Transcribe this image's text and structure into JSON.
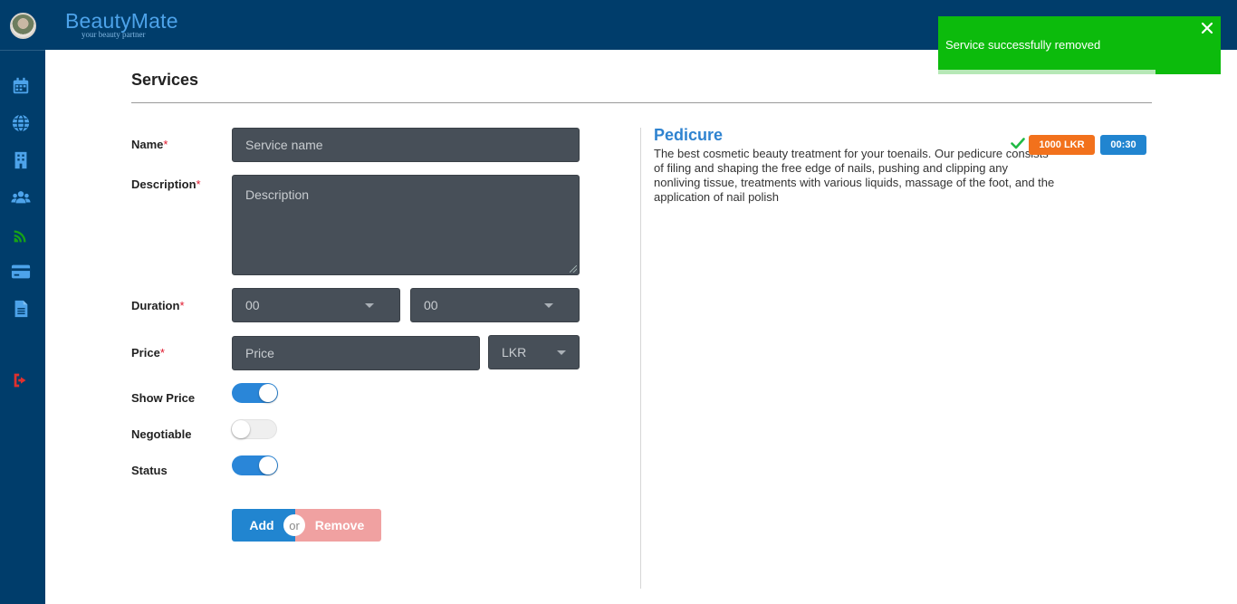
{
  "app": {
    "brand_name": "BeautyMate",
    "brand_tagline": "your beauty partner"
  },
  "sidebar": {
    "items": [
      {
        "icon": "calendar-icon",
        "color": "#4da3ea"
      },
      {
        "icon": "globe-icon",
        "color": "#4da3ea"
      },
      {
        "icon": "building-icon",
        "color": "#4da3ea"
      },
      {
        "icon": "users-icon",
        "color": "#4da3ea"
      },
      {
        "icon": "wifi-signal-icon",
        "color": "#17a317"
      },
      {
        "icon": "credit-card-icon",
        "color": "#4da3ea"
      },
      {
        "icon": "document-icon",
        "color": "#4da3ea"
      },
      {
        "icon": "sign-out-icon",
        "color": "#e0302e"
      }
    ]
  },
  "page": {
    "title": "Services"
  },
  "form": {
    "name": {
      "label": "Name",
      "required": "*",
      "placeholder": "Service name",
      "value": ""
    },
    "description": {
      "label": "Description",
      "required": "*",
      "placeholder": "Description",
      "value": ""
    },
    "duration": {
      "label": "Duration",
      "required": "*",
      "hours": "00",
      "minutes": "00"
    },
    "price": {
      "label": "Price",
      "required": "*",
      "placeholder": "Price",
      "value": "",
      "currency": "LKR"
    },
    "show_price": {
      "label": "Show Price",
      "checked": true
    },
    "negotiable": {
      "label": "Negotiable",
      "checked": false
    },
    "status": {
      "label": "Status",
      "checked": true
    },
    "add_label": "Add",
    "or_label": "or",
    "remove_label": "Remove"
  },
  "service_card": {
    "name": "Pedicure",
    "description": "The best cosmetic beauty treatment for your toenails. Our pedicure consists of filing and shaping the free edge of nails, pushing and clipping any nonliving tissue, treatments with various liquids, massage of the foot, and the application of nail polish",
    "status_icon": "check-icon",
    "price_badge": "1000 LKR",
    "duration_badge": "00:30"
  },
  "toast": {
    "message": "Service successfully removed",
    "progress": 0.77,
    "color": "#0cbb0c"
  }
}
